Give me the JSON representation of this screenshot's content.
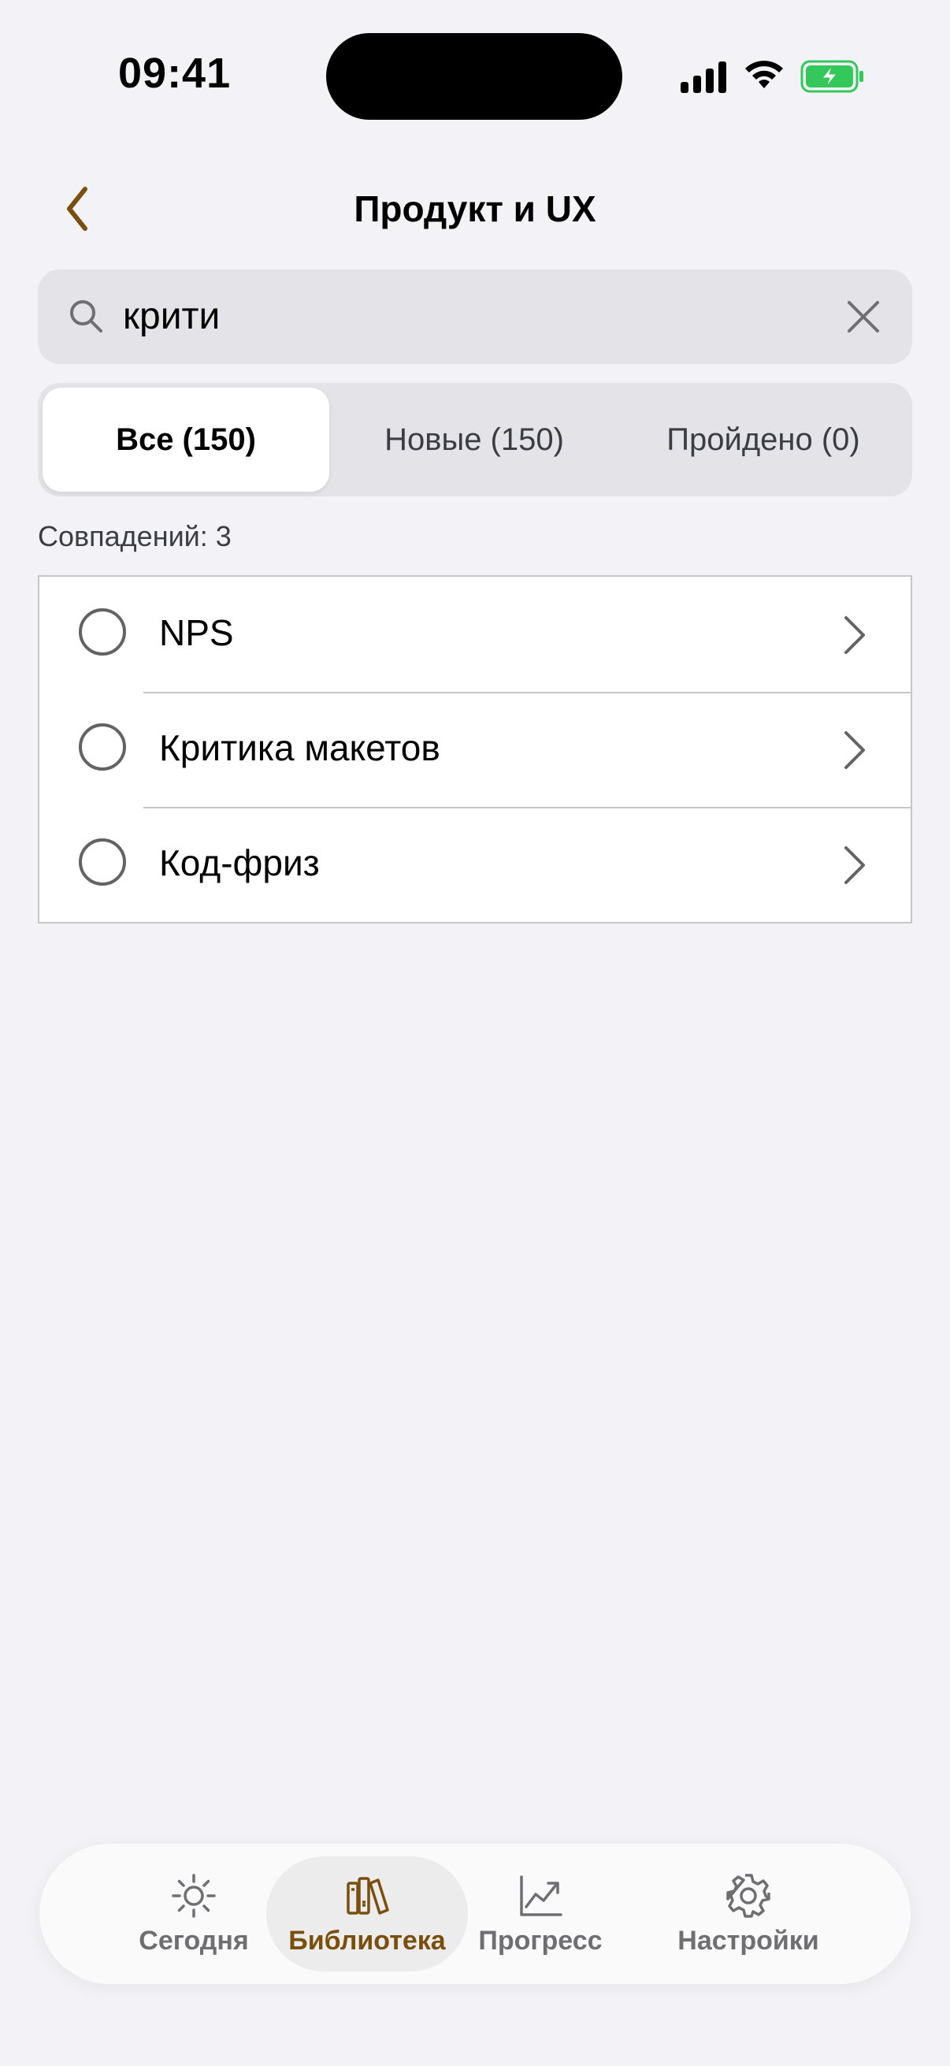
{
  "status": {
    "time": "09:41"
  },
  "nav": {
    "title": "Продукт и UX",
    "back_icon": "chevron-left-icon"
  },
  "search": {
    "value": "крити",
    "placeholder": "Поиск"
  },
  "segments": [
    {
      "label": "Все (150)",
      "selected": true
    },
    {
      "label": "Новые (150)",
      "selected": false
    },
    {
      "label": "Пройдено (0)",
      "selected": false
    }
  ],
  "matches_label": "Совпадений: 3",
  "items": [
    {
      "label": "NPS",
      "done": false
    },
    {
      "label": "Критика макетов",
      "done": false
    },
    {
      "label": "Код-фриз",
      "done": false
    }
  ],
  "tabbar": {
    "tabs": [
      {
        "label": "Сегодня",
        "icon": "sun-icon"
      },
      {
        "label": "Библиотека",
        "icon": "books-icon",
        "active": true
      },
      {
        "label": "Прогресс",
        "icon": "chart-icon"
      },
      {
        "label": "Настройки",
        "icon": "gear-icon"
      }
    ]
  },
  "colors": {
    "accent": "#7A4F0E",
    "background": "#F2F2F7",
    "battery_green": "#34C759"
  }
}
